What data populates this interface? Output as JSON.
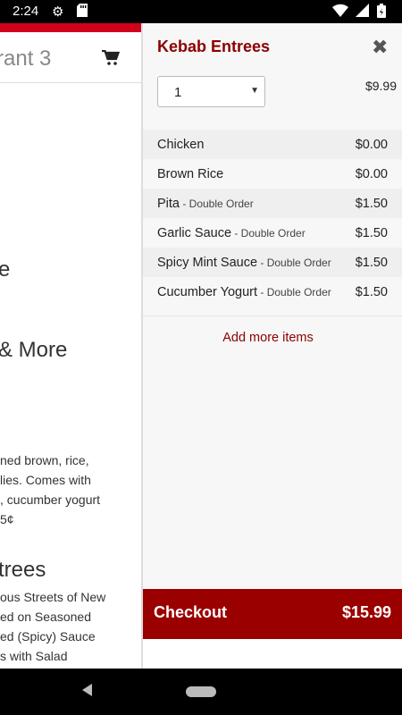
{
  "status_bar": {
    "time": "2:24"
  },
  "background_page": {
    "header_title": "rant 3",
    "headings": [
      "e",
      "& More",
      "trees"
    ],
    "description_lines": [
      "ned brown, rice,",
      "lies. Comes with",
      ", cucumber yogurt",
      "5¢"
    ],
    "entrees_lines": [
      "ous Streets of New",
      "ed on Seasoned",
      "ed (Spicy) Sauce",
      "s with Salad"
    ]
  },
  "drawer": {
    "title": "Kebab Entrees",
    "quantity": "1",
    "price": "$9.99",
    "options": [
      {
        "name": "Chicken",
        "suffix": "",
        "price": "$0.00"
      },
      {
        "name": "Brown Rice",
        "suffix": "",
        "price": "$0.00"
      },
      {
        "name": "Pita",
        "suffix": " - Double Order",
        "price": "$1.50"
      },
      {
        "name": "Garlic Sauce",
        "suffix": " - Double Order",
        "price": "$1.50"
      },
      {
        "name": "Spicy Mint Sauce",
        "suffix": " - Double Order",
        "price": "$1.50"
      },
      {
        "name": "Cucumber Yogurt",
        "suffix": " - Double Order",
        "price": "$1.50"
      }
    ],
    "add_more": "Add more items",
    "checkout_label": "Checkout",
    "checkout_total": "$15.99"
  },
  "colors": {
    "accent": "#8b0000",
    "checkout_bg": "#9b0000",
    "top_bar": "#d0021b"
  }
}
